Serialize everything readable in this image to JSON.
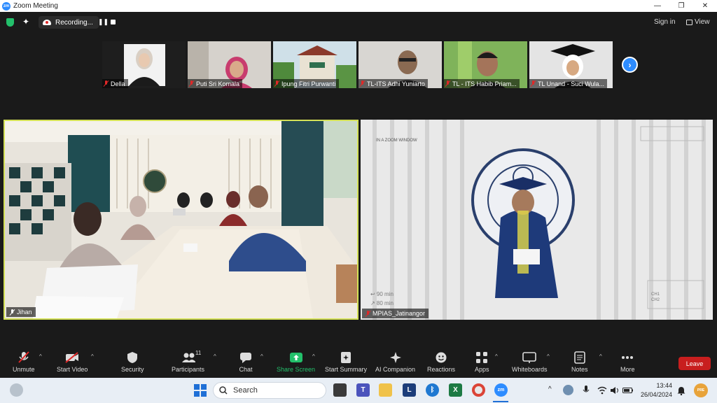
{
  "window": {
    "title": "Zoom Meeting",
    "logo_text": "zm",
    "controls": [
      "—",
      "❐",
      "✕"
    ]
  },
  "topbar": {
    "recording_label": "Recording...",
    "pause_glyph": "❚❚",
    "signin_label": "Sign in",
    "view_label": "View",
    "colors": {
      "shield": "#23c06b",
      "record_dot": "#e02828"
    }
  },
  "gallery": {
    "participants": [
      {
        "name": "Della",
        "muted": true
      },
      {
        "name": "Puti Sri Komala",
        "muted": true
      },
      {
        "name": "Ipung Fitri Purwanti",
        "muted": true
      },
      {
        "name": "TL-ITS Adhi Yuniarto",
        "muted": true
      },
      {
        "name": "TL - ITS Habib Priam...",
        "muted": true
      },
      {
        "name": "TL Unand - Suci Wula...",
        "muted": true
      }
    ],
    "next_glyph": "›"
  },
  "main_videos": {
    "left": {
      "name": "Jihan",
      "active_speaker": true
    },
    "right": {
      "name": "MPIAS_Jatinangor",
      "overlay_text": "IN A ZOOM WINDOW",
      "seal_text": "INSTITUT TEKNOLOGI BANDUNG",
      "hud_lines": [
        "↩ 90 min",
        "↗ 80 min"
      ],
      "channels": [
        "CH1",
        "CH2"
      ]
    }
  },
  "controls": {
    "items": [
      {
        "label": "Unmute",
        "icon": "mic-muted-icon"
      },
      {
        "label": "Start Video",
        "icon": "video-off-icon"
      },
      {
        "label": "Security",
        "icon": "shield-icon"
      },
      {
        "label": "Participants",
        "icon": "participants-icon",
        "badge": "11"
      },
      {
        "label": "Chat",
        "icon": "chat-icon"
      },
      {
        "label": "Share Screen",
        "icon": "share-screen-icon"
      },
      {
        "label": "Start Summary",
        "icon": "summary-icon"
      },
      {
        "label": "AI Companion",
        "icon": "ai-companion-icon"
      },
      {
        "label": "Reactions",
        "icon": "reactions-icon"
      },
      {
        "label": "Apps",
        "icon": "apps-icon"
      },
      {
        "label": "Whiteboards",
        "icon": "whiteboard-icon"
      },
      {
        "label": "Notes",
        "icon": "notes-icon"
      },
      {
        "label": "More",
        "icon": "more-icon"
      }
    ],
    "leave_label": "Leave",
    "colors": {
      "share": "#23c06b",
      "leave": "#c81e1e"
    }
  },
  "taskbar": {
    "search_placeholder": "Search",
    "time": "13:44",
    "date": "26/04/2024",
    "tray_badge": "PRE",
    "app_letter": "L",
    "excel_letter": "X",
    "zoom_letter": "zm"
  }
}
